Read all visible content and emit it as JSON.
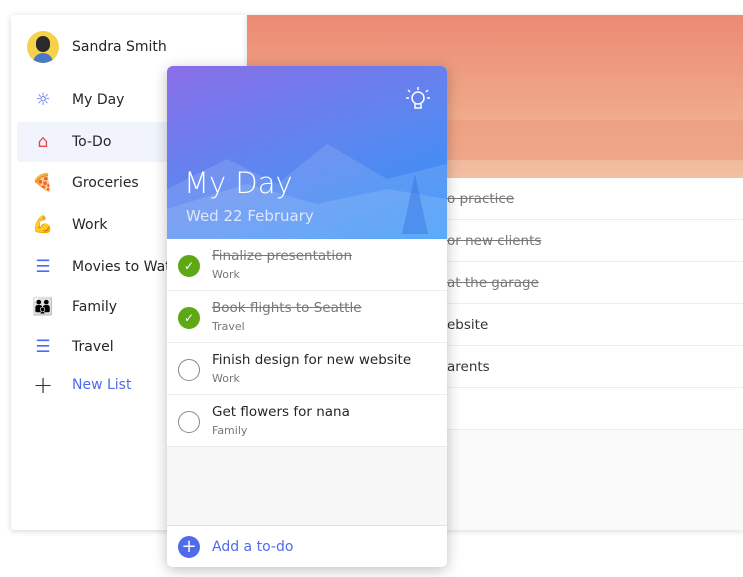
{
  "user": {
    "name": "Sandra Smith"
  },
  "sidebar": {
    "items": [
      {
        "label": "My Day",
        "icon": "sun-icon"
      },
      {
        "label": "To-Do",
        "icon": "home-check-icon",
        "selected": true
      },
      {
        "label": "Groceries",
        "icon": "pizza-icon"
      },
      {
        "label": "Work",
        "icon": "flexed-biceps-icon"
      },
      {
        "label": "Movies to Wat",
        "icon": "list-icon"
      },
      {
        "label": "Family",
        "icon": "family-icon"
      },
      {
        "label": "Travel",
        "icon": "list-icon"
      }
    ],
    "new_list": "New List"
  },
  "background_list": {
    "rows": [
      {
        "text": "o practice",
        "done": true
      },
      {
        "text": "or new clients",
        "done": true
      },
      {
        "text": "at the garage",
        "done": true
      },
      {
        "text": "ebsite",
        "done": false
      },
      {
        "text": "arents",
        "done": false
      },
      {
        "text": "",
        "done": false
      }
    ]
  },
  "card": {
    "title": "My Day",
    "date": "Wed 22 February",
    "tasks": [
      {
        "title": "Finalize presentation",
        "list": "Work",
        "done": true
      },
      {
        "title": "Book flights to Seattle",
        "list": "Travel",
        "done": true
      },
      {
        "title": "Finish design for new website",
        "list": "Work",
        "done": false
      },
      {
        "title": "Get flowers for nana",
        "list": "Family",
        "done": false
      }
    ],
    "add_label": "Add a to-do"
  },
  "colors": {
    "accent": "#4f6bed",
    "check": "#5ea815"
  }
}
